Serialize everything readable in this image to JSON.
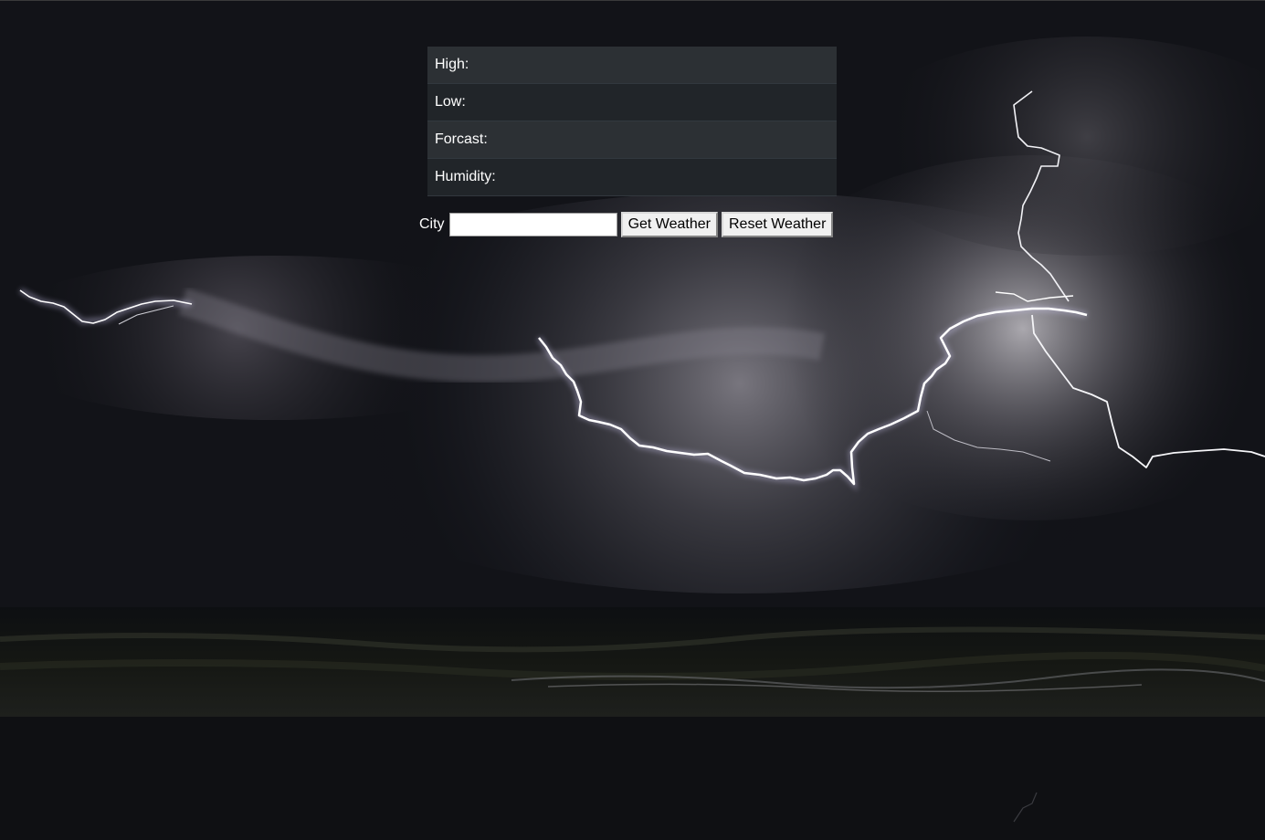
{
  "weather": {
    "rows": [
      {
        "label": "High:",
        "value": ""
      },
      {
        "label": "Low:",
        "value": ""
      },
      {
        "label": "Forcast:",
        "value": ""
      },
      {
        "label": "Humidity:",
        "value": ""
      }
    ]
  },
  "form": {
    "city_label": "City",
    "city_value": "",
    "get_button": "Get Weather",
    "reset_button": "Reset Weather"
  },
  "colors": {
    "table_row_odd": "#2c3034",
    "table_row_even": "#212529",
    "sky": "#0b0c10"
  }
}
